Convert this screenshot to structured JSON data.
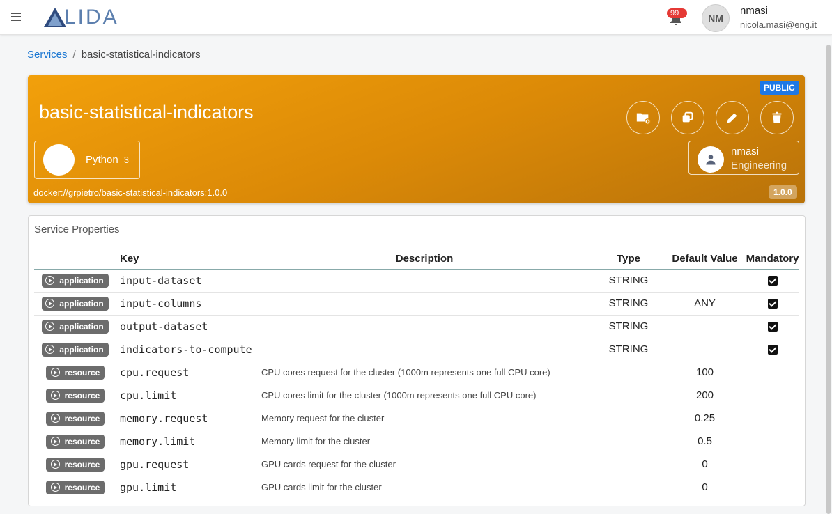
{
  "header": {
    "logo_text": "LIDA",
    "notification_count": "99+",
    "avatar_initials": "NM",
    "user_name": "nmasi",
    "user_email": "nicola.masi@eng.it"
  },
  "breadcrumb": {
    "root": "Services",
    "separator": "/",
    "current": "basic-statistical-indicators"
  },
  "service": {
    "title": "basic-statistical-indicators",
    "visibility": "PUBLIC",
    "environment_name": "Python",
    "environment_version": "3",
    "owner_name": "nmasi",
    "owner_org": "Engineering",
    "docker_url": "docker://grpietro/basic-statistical-indicators:1.0.0",
    "version": "1.0.0",
    "accent_color": "#f2a00b"
  },
  "properties": {
    "title": "Service Properties",
    "headers": {
      "key": "Key",
      "description": "Description",
      "type": "Type",
      "default": "Default Value",
      "mandatory": "Mandatory"
    },
    "rows": [
      {
        "tag": "application",
        "key": "input-dataset",
        "description": "",
        "type": "STRING",
        "default": "",
        "mandatory": true
      },
      {
        "tag": "application",
        "key": "input-columns",
        "description": "",
        "type": "STRING",
        "default": "ANY",
        "mandatory": true
      },
      {
        "tag": "application",
        "key": "output-dataset",
        "description": "",
        "type": "STRING",
        "default": "",
        "mandatory": true
      },
      {
        "tag": "application",
        "key": "indicators-to-compute",
        "description": "",
        "type": "STRING",
        "default": "",
        "mandatory": true
      },
      {
        "tag": "resource",
        "key": "cpu.request",
        "description": "CPU cores request for the cluster (1000m represents one full CPU core)",
        "type": "",
        "default": "100",
        "mandatory": false
      },
      {
        "tag": "resource",
        "key": "cpu.limit",
        "description": "CPU cores limit for the cluster (1000m represents one full CPU core)",
        "type": "",
        "default": "200",
        "mandatory": false
      },
      {
        "tag": "resource",
        "key": "memory.request",
        "description": "Memory request for the cluster",
        "type": "",
        "default": "0.25",
        "mandatory": false
      },
      {
        "tag": "resource",
        "key": "memory.limit",
        "description": "Memory limit for the cluster",
        "type": "",
        "default": "0.5",
        "mandatory": false
      },
      {
        "tag": "resource",
        "key": "gpu.request",
        "description": "GPU cards request for the cluster",
        "type": "",
        "default": "0",
        "mandatory": false
      },
      {
        "tag": "resource",
        "key": "gpu.limit",
        "description": "GPU cards limit for the cluster",
        "type": "",
        "default": "0",
        "mandatory": false
      }
    ]
  }
}
